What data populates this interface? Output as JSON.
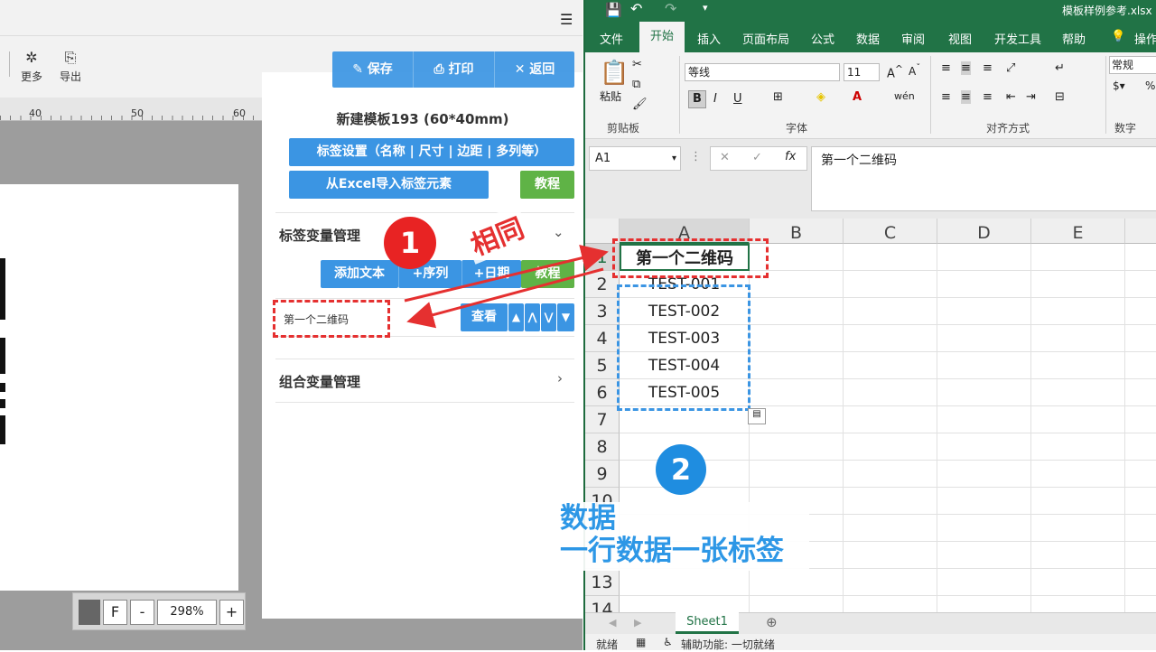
{
  "left_app": {
    "toolbar": {
      "more_label": "更多",
      "export_label": "导出"
    },
    "ruler": [
      "40",
      "50",
      "60"
    ],
    "zoom": {
      "f_label": "F",
      "minus_label": "-",
      "value": "298%",
      "plus_label": "+"
    }
  },
  "panel": {
    "save_label": "保存",
    "print_label": "打印",
    "back_label": "返回",
    "template_title": "新建模板193 (60*40mm)",
    "label_settings_label": "标签设置（名称 | 尺寸 | 边距 | 多列等）",
    "import_excel_label": "从Excel导入标签元素",
    "tutorial_label": "教程",
    "var_section_title": "标签变量管理",
    "add_text_label": "添加文本",
    "add_serial_label": "+序列",
    "add_date_label": "+日期",
    "tutorial2_label": "教程",
    "variable_name": "第一个二维码",
    "view_label": "查看",
    "group_section_title": "组合变量管理"
  },
  "excel": {
    "filename": "模板样例参考.xlsx",
    "tabs": [
      "文件",
      "开始",
      "插入",
      "页面布局",
      "公式",
      "数据",
      "审阅",
      "视图",
      "开发工具",
      "帮助",
      "操作"
    ],
    "active_tab": "开始",
    "font_name": "等线",
    "font_size": "11",
    "number_format": "常规",
    "groups": {
      "clipboard": "剪贴板",
      "font": "字体",
      "alignment": "对齐方式",
      "number": "数字"
    },
    "paste_label": "粘贴",
    "name_box": "A1",
    "formula": "第一个二维码",
    "columns": [
      "A",
      "B",
      "C",
      "D",
      "E"
    ],
    "rows": [
      "1",
      "2",
      "3",
      "4",
      "5",
      "6",
      "7",
      "8",
      "9",
      "10",
      "",
      "",
      "13",
      "14"
    ],
    "cells_a": [
      "第一个二维码",
      "TEST-001",
      "TEST-002",
      "TEST-003",
      "TEST-004",
      "TEST-005"
    ],
    "sheet_tab": "Sheet1",
    "status_ready": "就绪",
    "status_accessibility": "辅助功能: 一切就绪"
  },
  "annotations": {
    "badge1": "1",
    "same_label": "相同",
    "badge2": "2",
    "data_line1": "数据",
    "data_line2": "一行数据一张标签"
  },
  "colors": {
    "accent_blue": "#3b95e3",
    "green": "#5fb346",
    "excel_green": "#217346",
    "annotation_red": "#e53030"
  }
}
